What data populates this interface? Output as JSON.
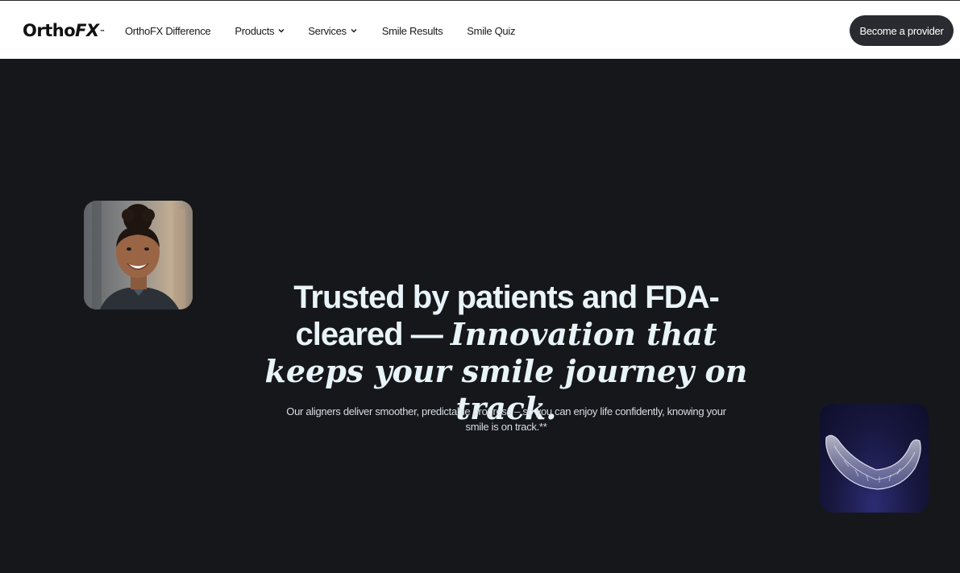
{
  "brand": {
    "name_part1": "Ortho",
    "name_part2": "FX",
    "trademark": "™"
  },
  "nav": {
    "items": [
      {
        "label": "OrthoFX Difference",
        "has_dropdown": false
      },
      {
        "label": "Products",
        "has_dropdown": true
      },
      {
        "label": "Services",
        "has_dropdown": true
      },
      {
        "label": "Smile Results",
        "has_dropdown": false
      },
      {
        "label": "Smile Quiz",
        "has_dropdown": false
      }
    ],
    "cta_label": "Become a provider"
  },
  "hero": {
    "headline_plain": "Trusted by patients and FDA-cleared — ",
    "headline_italic": "Innovation that keeps your smile journey on track.",
    "subtext": "Our aligners deliver smoother, predictable progress – so you can enjoy life confidently, knowing your smile is on track.**"
  },
  "colors": {
    "background": "#16171b",
    "header_bg": "#ffffff",
    "cta_bg": "#2a2b30",
    "headline": "#e8f4f8"
  },
  "icons": {
    "dropdown": "chevron-down-icon",
    "hero_left": "smiling-woman-photo",
    "hero_right": "clear-aligner-photo"
  }
}
